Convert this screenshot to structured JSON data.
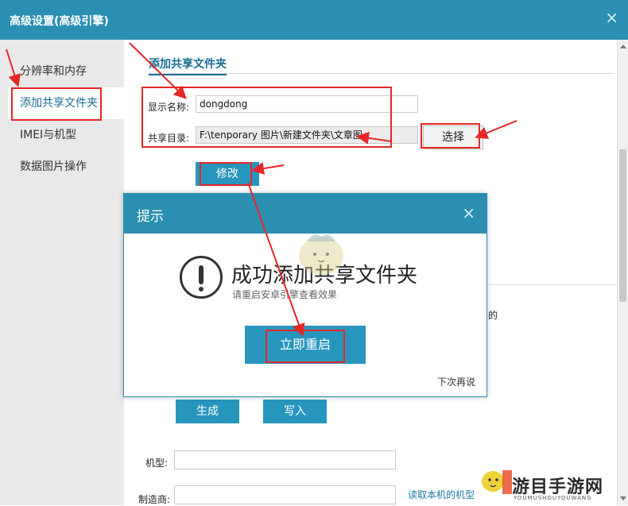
{
  "window": {
    "title": "高级设置(高级引擎)",
    "close_icon": "×"
  },
  "sidebar": {
    "items": [
      {
        "label": "分辨率和内存",
        "active": false
      },
      {
        "label": "添加共享文件夹",
        "active": true
      },
      {
        "label": "IMEI与机型",
        "active": false
      },
      {
        "label": "数据图片操作",
        "active": false
      }
    ]
  },
  "share": {
    "section_title": "添加共享文件夹",
    "name_label": "显示名称:",
    "name_value": "dongdong",
    "dir_label": "共享目录:",
    "dir_value": "F:\\tenporary 图片\\新建文件夹\\文章图",
    "choose_button": "选择",
    "modify_button": "修改"
  },
  "other": {
    "fragment": "的",
    "generate_button": "生成",
    "write_button": "写入",
    "model_label": "机型:",
    "maker_label": "制造商:",
    "read_model_link": "读取本机的机型"
  },
  "modal": {
    "title": "提示",
    "close_icon": "×",
    "message": "成功添加共享文件夹",
    "sub_message": "请重启安卓引擎查看效果",
    "restart_button": "立即重启",
    "later_link": "下次再说"
  },
  "watermark": {
    "text": "游目手游网",
    "sub": "YOUMUSHOUYOUWANG"
  },
  "colors": {
    "accent": "#2a8fb1",
    "button_blue": "#2796bd",
    "annotation_red": "#e52727",
    "sidebar_bg": "#e9e9e9"
  }
}
